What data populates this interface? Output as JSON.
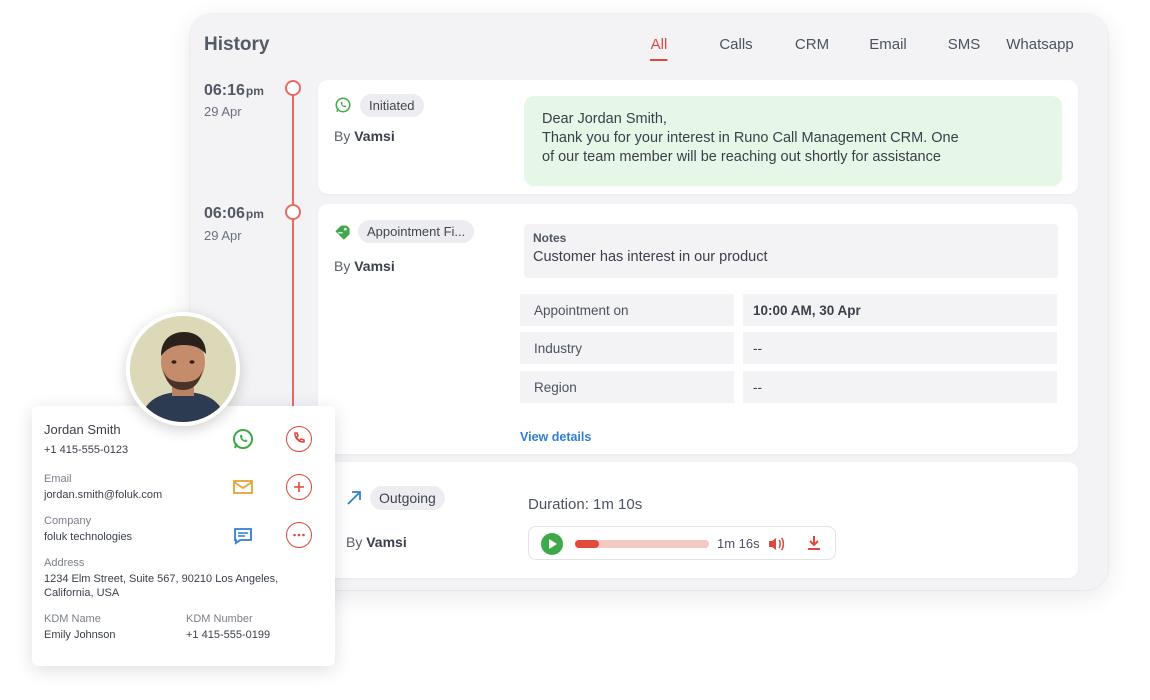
{
  "history": {
    "title": "History",
    "tabs": [
      "All",
      "Calls",
      "CRM",
      "Email",
      "SMS",
      "Whatsapp"
    ],
    "active_tab": "All"
  },
  "entries": [
    {
      "time": "06:16",
      "ampm": "pm",
      "date": "29 Apr",
      "chip": "Initiated",
      "by_prefix": "By",
      "by_name": "Vamsi",
      "message_lines": [
        "Dear Jordan Smith,",
        "Thank you for your interest in Runo Call Management CRM. One",
        "of our team member will be reaching out shortly for assistance"
      ]
    },
    {
      "time": "06:06",
      "ampm": "pm",
      "date": "29 Apr",
      "chip": "Appointment Fi...",
      "by_prefix": "By",
      "by_name": "Vamsi",
      "notes_label": "Notes",
      "notes_text": "Customer has interest in our product",
      "fields": [
        {
          "label": "Appointment on",
          "value": "10:00 AM, 30 Apr"
        },
        {
          "label": "Industry",
          "value": "--"
        },
        {
          "label": "Region",
          "value": "--"
        }
      ],
      "view_details": "View details"
    },
    {
      "chip": "Outgoing",
      "by_prefix": "By",
      "by_name": "Vamsi",
      "duration": "Duration: 1m 10s",
      "player_time": "1m 16s",
      "progress": 0.18
    }
  ],
  "contact": {
    "name": "Jordan Smith",
    "phone": "+1 415-555-0123",
    "email_label": "Email",
    "email": "jordan.smith@foluk.com",
    "company_label": "Company",
    "company": "foluk technologies",
    "address_label": "Address",
    "address_lines": [
      "1234 Elm Street, Suite 567, 90210 Los Angeles,",
      "California, USA"
    ],
    "kdm_name_label": "KDM Name",
    "kdm_name": "Emily Johnson",
    "kdm_number_label": "KDM Number",
    "kdm_number": "+1 415-555-0199"
  },
  "colors": {
    "accent": "#e0473c",
    "whatsapp": "#3fa84a",
    "link": "#2f7fd3",
    "message_bg": "#e6f6e7"
  },
  "icons": [
    "whatsapp-icon",
    "tag-icon",
    "outgoing-arrow-icon",
    "play-icon",
    "volume-icon",
    "download-icon",
    "phone-icon",
    "mail-icon",
    "plus-icon",
    "chat-icon",
    "more-icon"
  ]
}
